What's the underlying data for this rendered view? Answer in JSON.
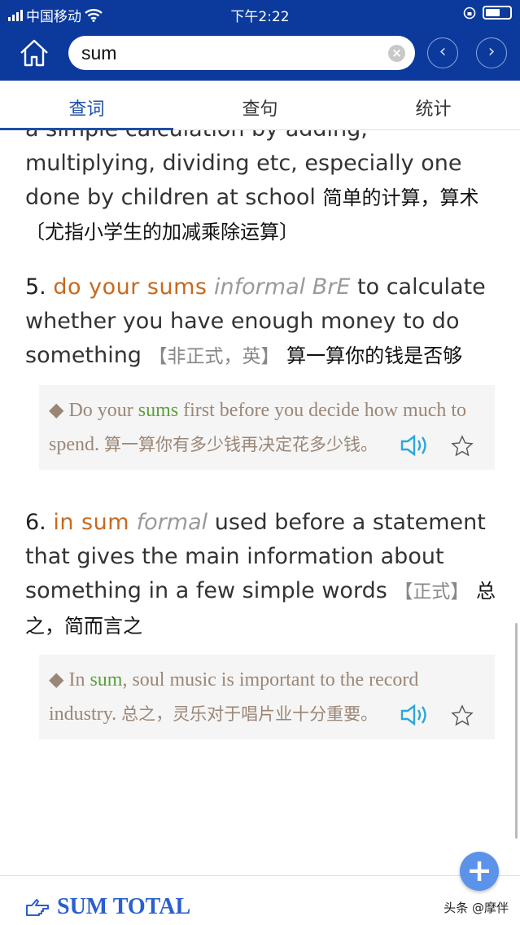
{
  "status": {
    "carrier": "中国移动",
    "time": "下午2:22"
  },
  "search": {
    "value": "sum",
    "clear_icon": "clear-icon"
  },
  "tabs": [
    {
      "label": "查词",
      "active": true
    },
    {
      "label": "查句"
    },
    {
      "label": "统计"
    }
  ],
  "entries": {
    "prev": {
      "text_en": "a simple calculation by adding, multiplying, dividing etc, especially one done by children at school",
      "text_cn": "简单的计算，算术〔尤指小学生的加减乘除运算〕"
    },
    "e5": {
      "num": "5.",
      "phrase": "do your sums",
      "register": "informal BrE",
      "definition": "to calculate whether you have enough money to do something",
      "label": "【非正式，英】",
      "cn": "算一算你的钱是否够",
      "example": {
        "pre": "◆ Do your ",
        "hl": "sums",
        "post": " first before you decide how much to spend.",
        "cn": "算一算你有多少钱再决定花多少钱。"
      }
    },
    "e6": {
      "num": "6.",
      "phrase": "in sum",
      "register": "formal",
      "definition": "used before a statement that gives the main information about something in a few simple words",
      "label": "【正式】",
      "cn": "总之，简而言之",
      "example": {
        "pre": "◆ In ",
        "hl": "sum",
        "post": ", soul music is important to the record industry.",
        "cn": "总之，灵乐对于唱片业十分重要。"
      }
    }
  },
  "footer": {
    "section_title": "SUM TOTAL",
    "watermark": "头条 @摩伴"
  },
  "colors": {
    "header": "#0b3a9c",
    "accent": "#1f4fa6",
    "phrase": "#c8691e",
    "highlight": "#5aa03c",
    "fab": "#5b93ea"
  }
}
